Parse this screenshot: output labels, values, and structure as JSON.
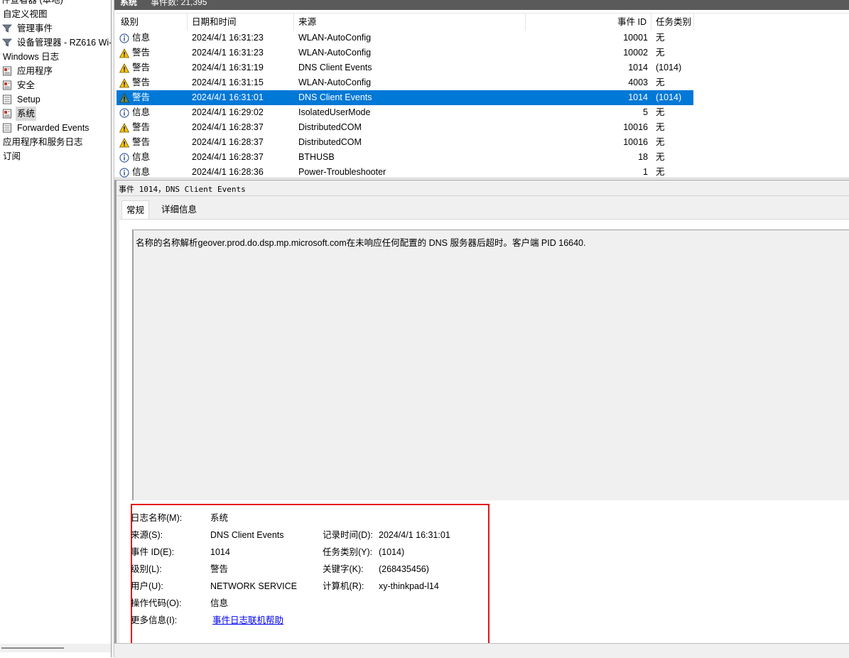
{
  "tree": {
    "items": [
      {
        "label": "件查看器 (本地)",
        "icon": "event-viewer-icon",
        "indent": 0
      },
      {
        "label": "自定义视图",
        "icon": "",
        "indent": 0
      },
      {
        "label": "管理事件",
        "icon": "filter-icon",
        "indent": 1
      },
      {
        "label": "设备管理器 - RZ616 Wi-",
        "icon": "filter-icon",
        "indent": 1
      },
      {
        "label": "Windows 日志",
        "icon": "",
        "indent": 0
      },
      {
        "label": "应用程序",
        "icon": "log-icon",
        "indent": 1
      },
      {
        "label": "安全",
        "icon": "log-icon",
        "indent": 1
      },
      {
        "label": "Setup",
        "icon": "log-icon",
        "indent": 1
      },
      {
        "label": "系统",
        "icon": "log-icon",
        "indent": 1,
        "selected": true
      },
      {
        "label": "Forwarded Events",
        "icon": "log-icon",
        "indent": 1
      },
      {
        "label": "应用程序和服务日志",
        "icon": "",
        "indent": 0
      },
      {
        "label": "订阅",
        "icon": "",
        "indent": 0
      }
    ]
  },
  "header": {
    "log_name": "系统",
    "event_count": "事件数: 21,395"
  },
  "columns": {
    "level": "级别",
    "date": "日期和时间",
    "source": "来源",
    "event_id": "事件 ID",
    "task": "任务类别"
  },
  "rows": [
    {
      "level": "信息",
      "icon": "info-icon",
      "date": "2024/4/1 16:31:23",
      "source": "WLAN-AutoConfig",
      "event_id": "10001",
      "task": "无"
    },
    {
      "level": "警告",
      "icon": "warning-icon",
      "date": "2024/4/1 16:31:23",
      "source": "WLAN-AutoConfig",
      "event_id": "10002",
      "task": "无"
    },
    {
      "level": "警告",
      "icon": "warning-icon",
      "date": "2024/4/1 16:31:19",
      "source": "DNS Client Events",
      "event_id": "1014",
      "task": "(1014)"
    },
    {
      "level": "警告",
      "icon": "warning-icon",
      "date": "2024/4/1 16:31:15",
      "source": "WLAN-AutoConfig",
      "event_id": "4003",
      "task": "无"
    },
    {
      "level": "警告",
      "icon": "warning-icon",
      "date": "2024/4/1 16:31:01",
      "source": "DNS Client Events",
      "event_id": "1014",
      "task": "(1014)",
      "selected": true
    },
    {
      "level": "信息",
      "icon": "info-icon",
      "date": "2024/4/1 16:29:02",
      "source": "IsolatedUserMode",
      "event_id": "5",
      "task": "无"
    },
    {
      "level": "警告",
      "icon": "warning-icon",
      "date": "2024/4/1 16:28:37",
      "source": "DistributedCOM",
      "event_id": "10016",
      "task": "无"
    },
    {
      "level": "警告",
      "icon": "warning-icon",
      "date": "2024/4/1 16:28:37",
      "source": "DistributedCOM",
      "event_id": "10016",
      "task": "无"
    },
    {
      "level": "信息",
      "icon": "info-icon",
      "date": "2024/4/1 16:28:37",
      "source": "BTHUSB",
      "event_id": "18",
      "task": "无"
    },
    {
      "level": "信息",
      "icon": "info-icon",
      "date": "2024/4/1 16:28:36",
      "source": "Power-Troubleshooter",
      "event_id": "1",
      "task": "无"
    }
  ],
  "detail": {
    "title": "事件 1014，DNS Client Events",
    "tabs": [
      "常规",
      "详细信息"
    ],
    "description": "名称的名称解析geover.prod.do.dsp.mp.microsoft.com在未响应任何配置的 DNS 服务器后超时。客户端 PID 16640.",
    "props": {
      "log_name_label": "日志名称(M):",
      "log_name": "系统",
      "source_label": "来源(S):",
      "source": "DNS Client Events",
      "logged_label": "记录时间(D):",
      "logged": "2024/4/1 16:31:01",
      "event_id_label": "事件 ID(E):",
      "event_id": "1014",
      "task_label": "任务类别(Y):",
      "task": "(1014)",
      "level_label": "级别(L):",
      "level": "警告",
      "keywords_label": "关键字(K):",
      "keywords": "(268435456)",
      "user_label": "用户(U):",
      "user": "NETWORK SERVICE",
      "computer_label": "计算机(R):",
      "computer": "xy-thinkpad-l14",
      "opcode_label": "操作代码(O):",
      "opcode": "信息",
      "more_info_label": "更多信息(I):",
      "more_info_link": "事件日志联机帮助"
    }
  }
}
